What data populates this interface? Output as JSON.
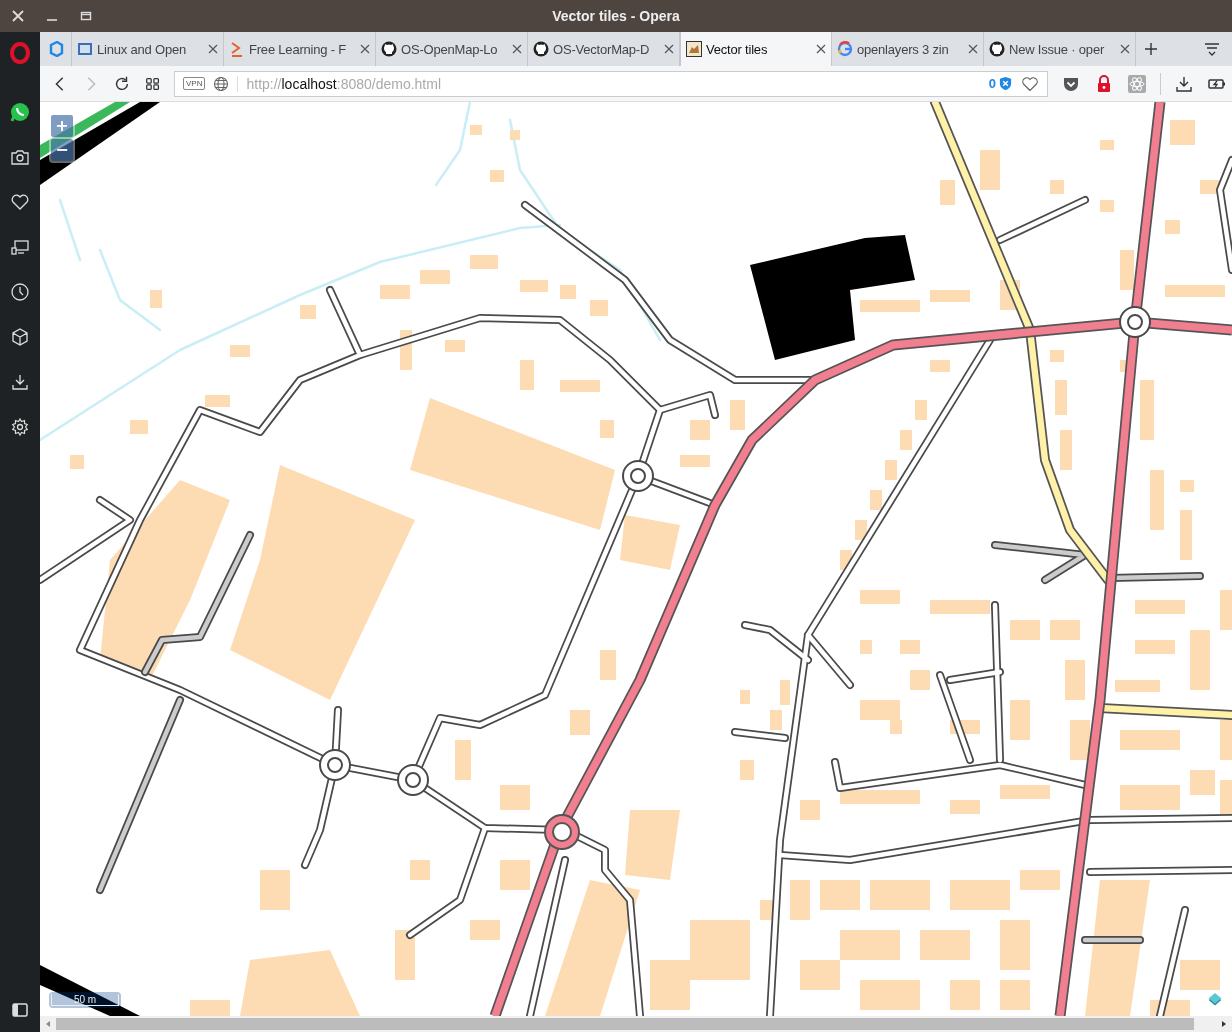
{
  "window": {
    "title": "Vector tiles - Opera"
  },
  "tabs": [
    {
      "selected": false
    },
    {
      "label": "Linux and Open",
      "selected": false
    },
    {
      "label": "Free Learning - F",
      "selected": false
    },
    {
      "label": "OS-OpenMap-Lo",
      "selected": false
    },
    {
      "label": "OS-VectorMap-D",
      "selected": false
    },
    {
      "label": "Vector tiles",
      "selected": true
    },
    {
      "label": "openlayers 3 zin",
      "selected": false
    },
    {
      "label": "New Issue · oper",
      "selected": false
    }
  ],
  "address": {
    "scheme": "http://",
    "host": "localhost",
    "path": ":8080/demo.html",
    "vpn": "VPN",
    "blocked_count": "0"
  },
  "map": {
    "zoom_in": "+",
    "zoom_out": "−",
    "scale": "50 m"
  }
}
